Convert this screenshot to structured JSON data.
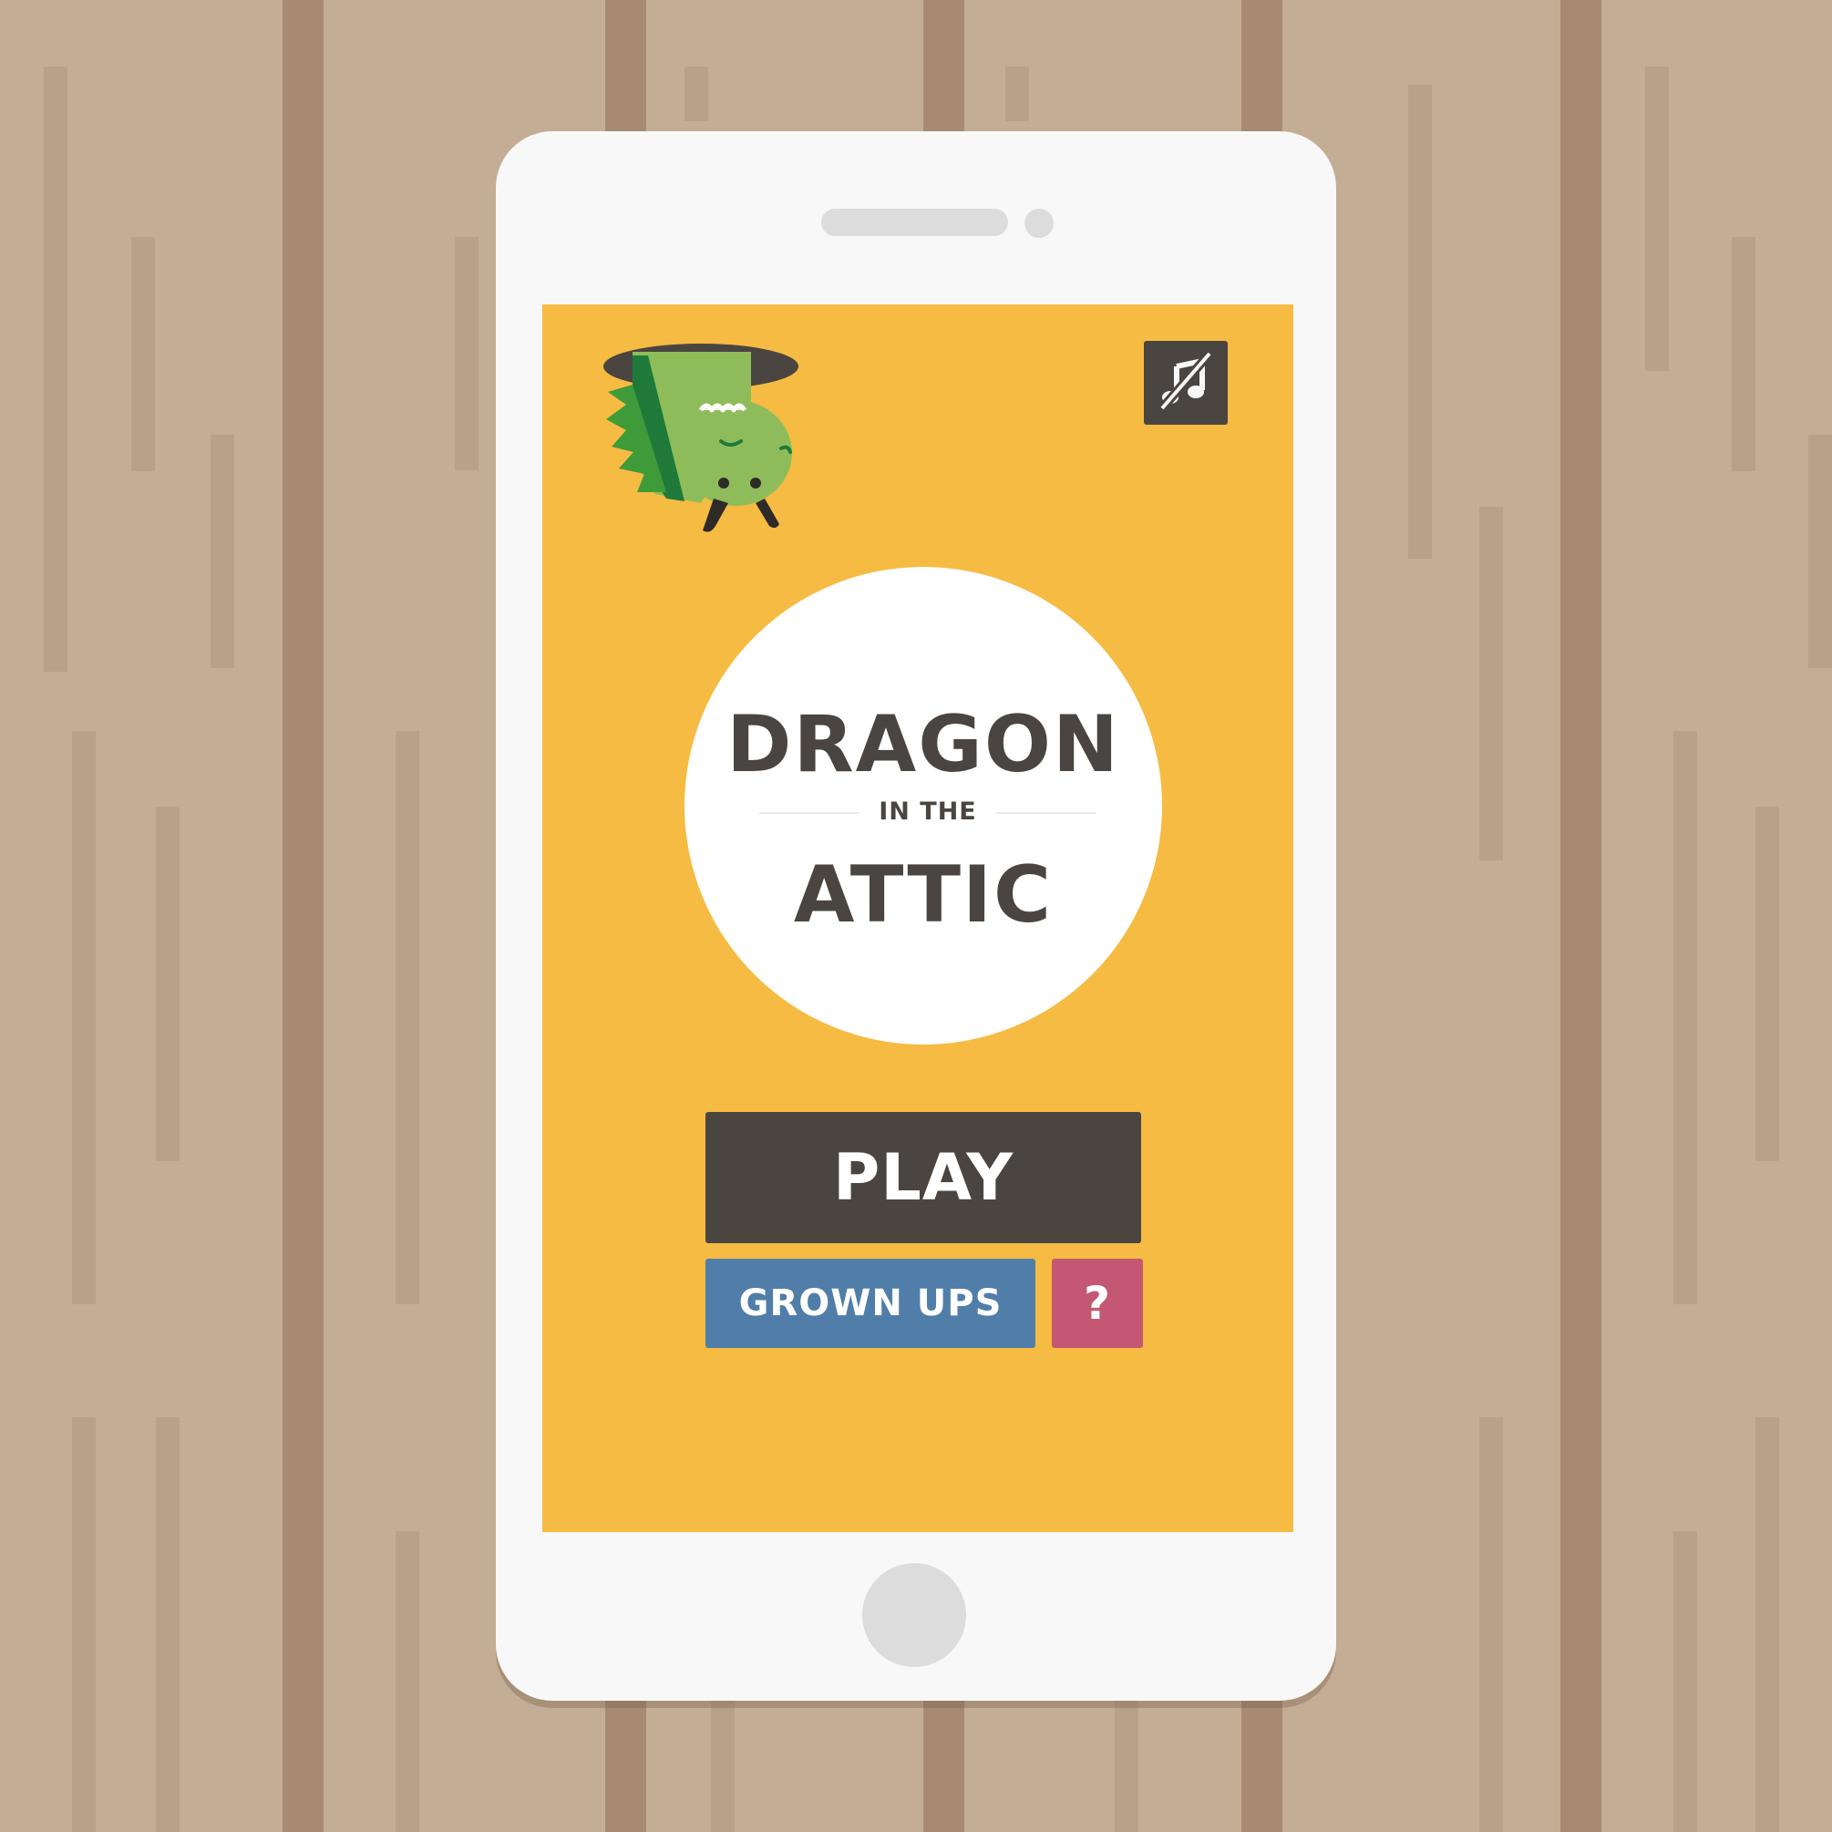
{
  "app": {
    "title_line_1": "DRAGON",
    "title_line_2": "IN THE",
    "title_line_3": "ATTIC"
  },
  "menu": {
    "play_label": "PLAY",
    "grown_ups_label": "GROWN UPS",
    "help_label": "?"
  },
  "icons": {
    "mute": "music-muted-icon",
    "mascot": "dragon-mascot-icon"
  },
  "colors": {
    "background_wood": "#c3ad94",
    "screen_background": "#f6bb42",
    "dark_brown": "#4a4540",
    "grown_ups_blue": "#507ea9",
    "help_pink": "#c45873",
    "dragon_green": "#8fbc5a"
  }
}
